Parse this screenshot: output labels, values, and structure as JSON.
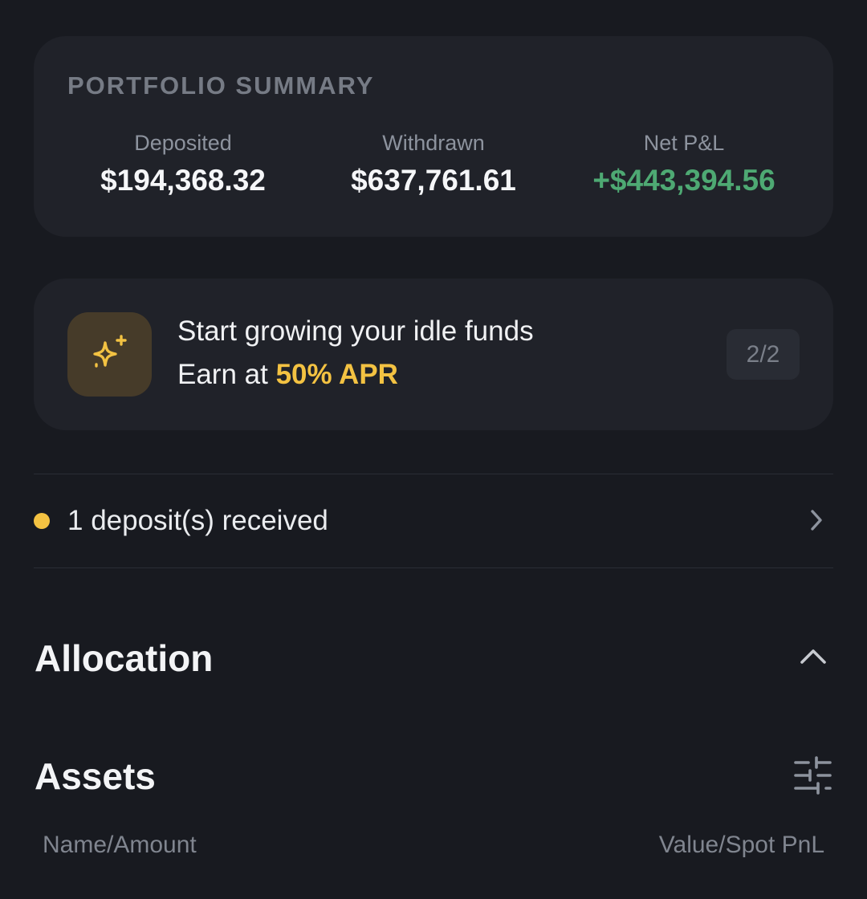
{
  "summary": {
    "title": "PORTFOLIO SUMMARY",
    "deposited": {
      "label": "Deposited",
      "value": "$194,368.32"
    },
    "withdrawn": {
      "label": "Withdrawn",
      "value": "$637,761.61"
    },
    "net_pnl": {
      "label": "Net P&L",
      "value": "+$443,394.56"
    }
  },
  "promo": {
    "icon": "sparkle-icon",
    "line1": "Start growing your idle funds",
    "line2_prefix": "Earn at ",
    "line2_highlight": "50% APR",
    "pager": "2/2"
  },
  "deposit_notice": {
    "text": "1 deposit(s) received"
  },
  "allocation": {
    "title": "Allocation"
  },
  "assets": {
    "title": "Assets",
    "col_left": "Name/Amount",
    "col_right": "Value/Spot PnL"
  },
  "colors": {
    "background": "#181a20",
    "card": "#202229",
    "accent_yellow": "#f3c242",
    "positive_green": "#4ea973"
  }
}
